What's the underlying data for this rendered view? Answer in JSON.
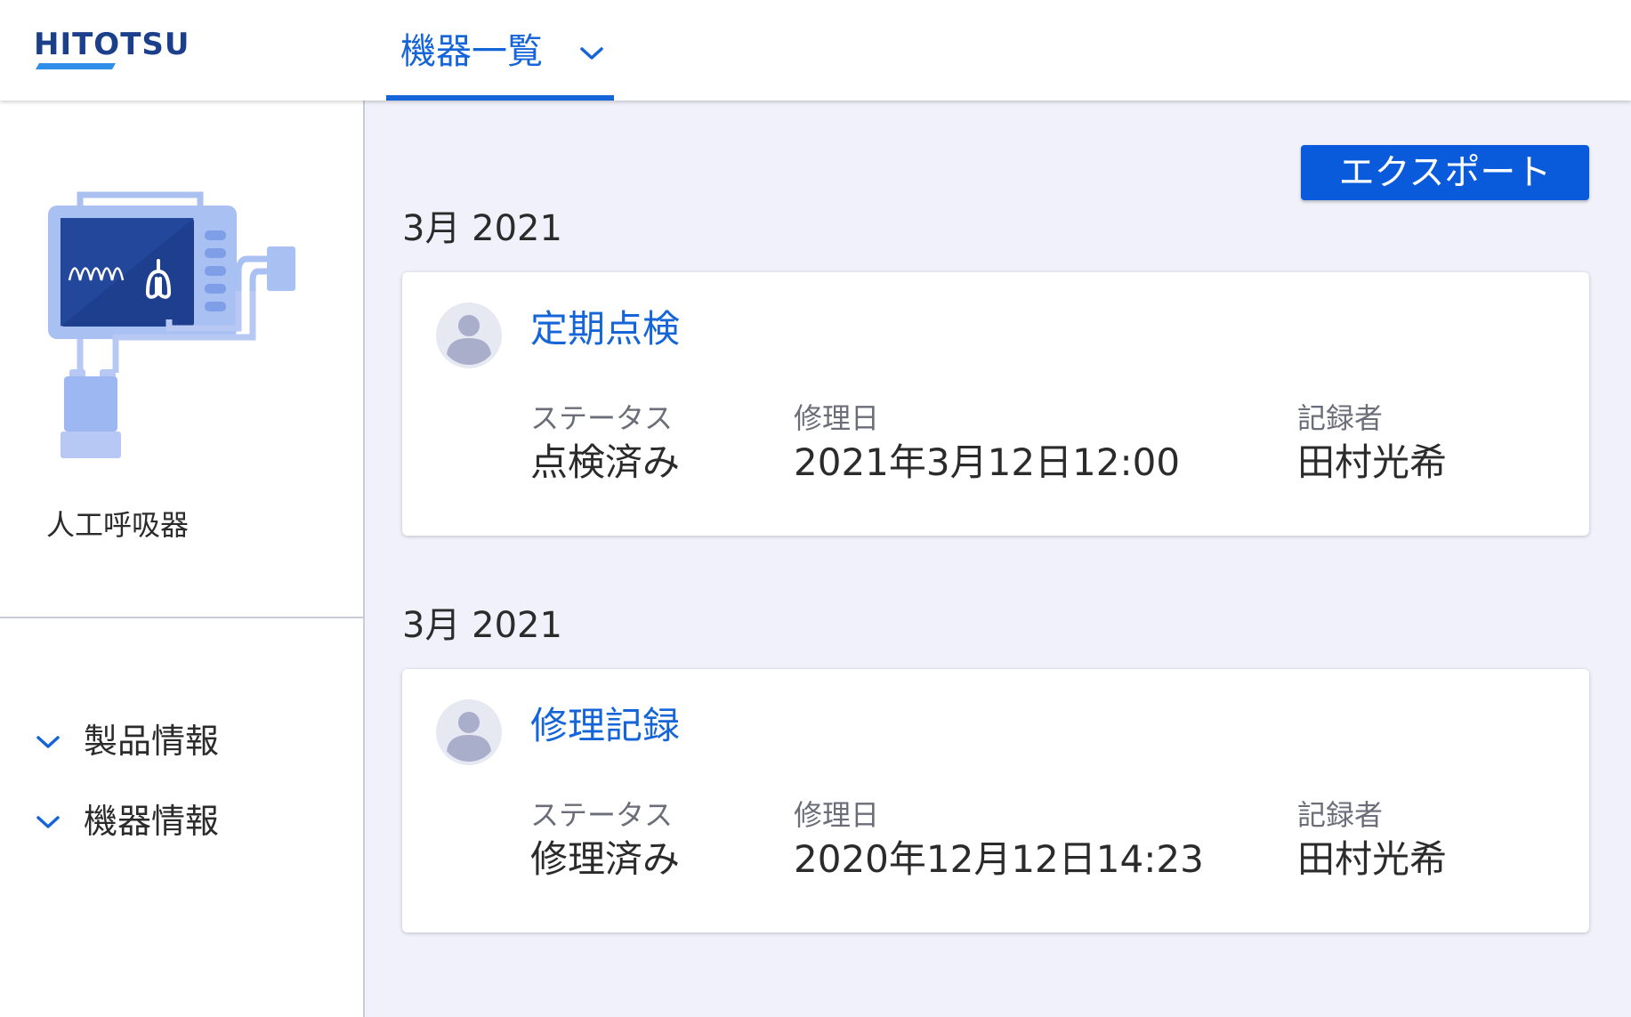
{
  "header": {
    "logo": "HITOTSU",
    "tab_label": "機器一覧"
  },
  "sidebar": {
    "device_name": "人工呼吸器",
    "items": [
      {
        "label": "製品情報"
      },
      {
        "label": "機器情報"
      }
    ]
  },
  "main": {
    "export_label": "エクスポート",
    "groups": [
      {
        "month": "3月 2021",
        "record": {
          "title": "定期点検",
          "status_label": "ステータス",
          "status_value": "点検済み",
          "date_label": "修理日",
          "date_value": "2021年3月12日12:00",
          "recorder_label": "記録者",
          "recorder_value": "田村光希"
        }
      },
      {
        "month": "3月 2021",
        "record": {
          "title": "修理記録",
          "status_label": "ステータス",
          "status_value": "修理済み",
          "date_label": "修理日",
          "date_value": "2020年12月12日14:23",
          "recorder_label": "記録者",
          "recorder_value": "田村光希"
        }
      }
    ]
  },
  "colors": {
    "accent": "#1565d8",
    "button": "#0a5bdc",
    "logo": "#1c3f8c",
    "background": "#f0f1fa"
  }
}
